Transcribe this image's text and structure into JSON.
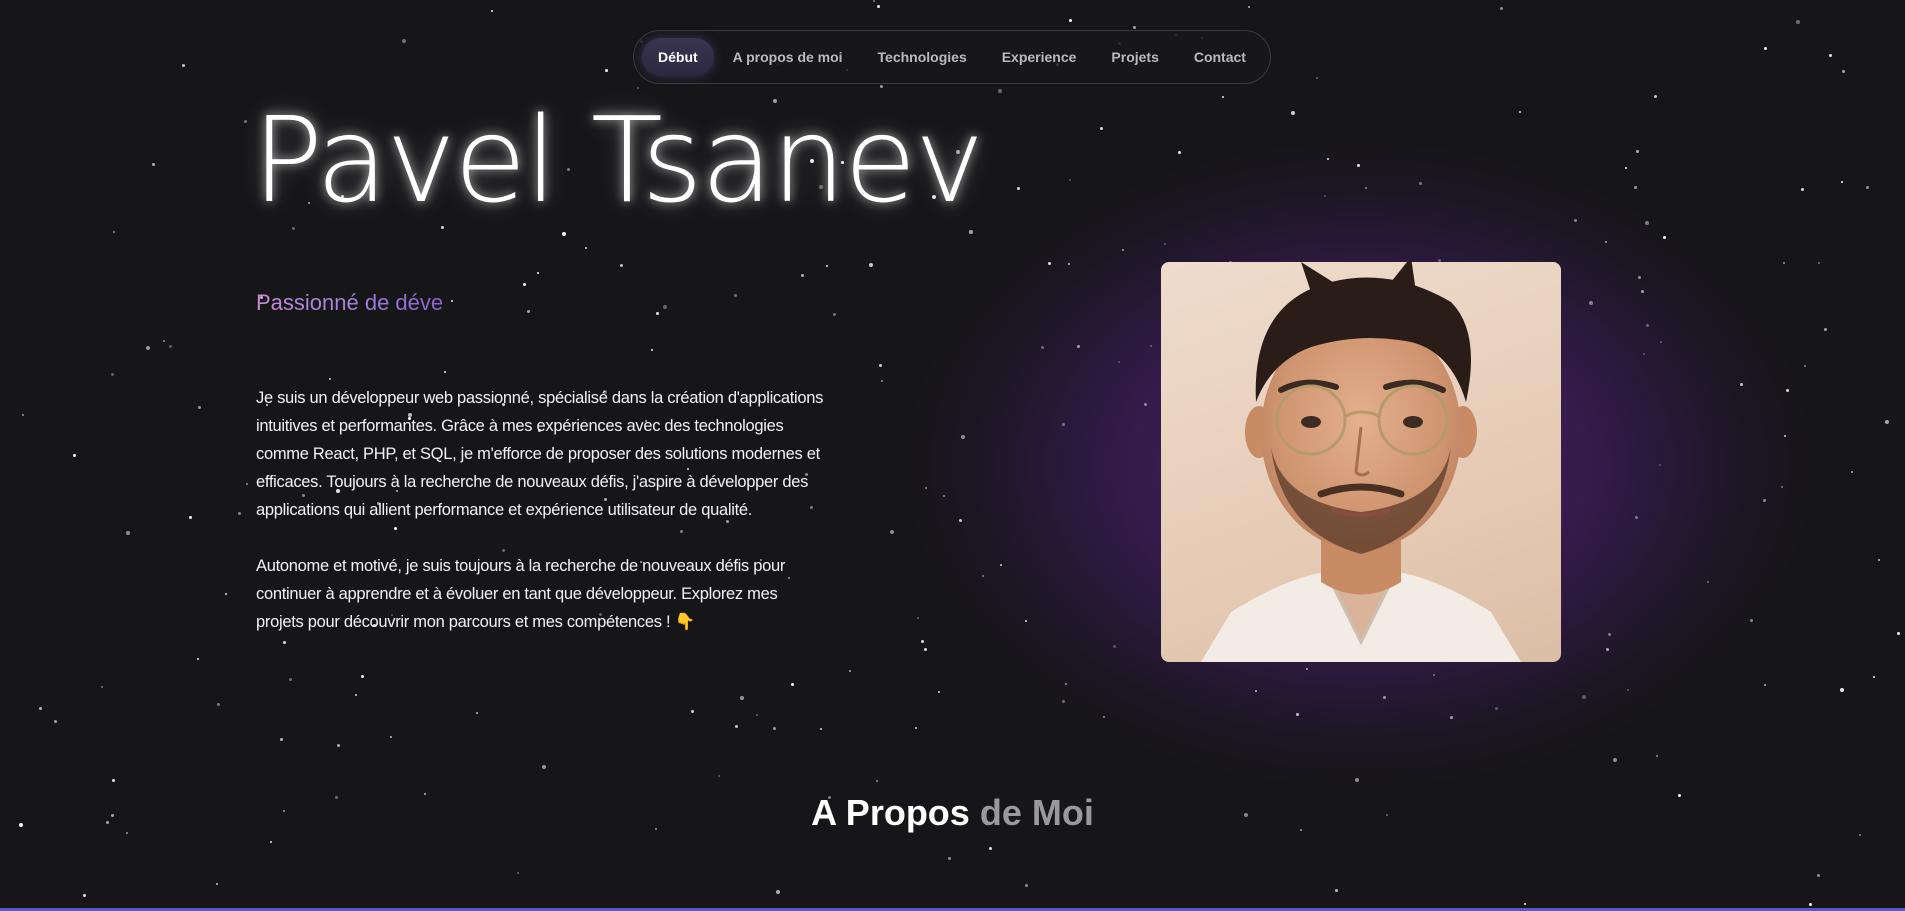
{
  "nav": {
    "items": [
      {
        "label": "Début",
        "active": true
      },
      {
        "label": "A propos de moi",
        "active": false
      },
      {
        "label": "Technologies",
        "active": false
      },
      {
        "label": "Experience",
        "active": false
      },
      {
        "label": "Projets",
        "active": false
      },
      {
        "label": "Contact",
        "active": false
      }
    ]
  },
  "hero": {
    "name": "Pavel Tsanev",
    "subtitle": "Passionné de déve",
    "paragraphs": [
      "Je suis un développeur web passionné, spécialisé dans la création d'applications intuitives et performantes. Grâce à mes expériences avec des technologies comme React, PHP, et SQL, je m'efforce de proposer des solutions modernes et efficaces. Toujours à la recherche de nouveaux défis, j'aspire à développer des applications qui allient performance et expérience utilisateur de qualité.",
      "Autonome et motivé, je suis toujours à la recherche de nouveaux défis pour continuer à apprendre et à évoluer en tant que développeur. Explorez mes projets pour découvrir mon parcours et mes compétences ! 👇"
    ],
    "portrait_icon": "portrait-photo"
  },
  "about_section": {
    "title_part1": "A Propos",
    "title_part2": "de Moi"
  },
  "colors": {
    "background": "#161618",
    "accent_purple": "#7a3cc0",
    "subtitle_gradient_start": "#c98ad8",
    "subtitle_gradient_end": "#8f5fd0",
    "bottom_bar": "#5b54c8"
  }
}
